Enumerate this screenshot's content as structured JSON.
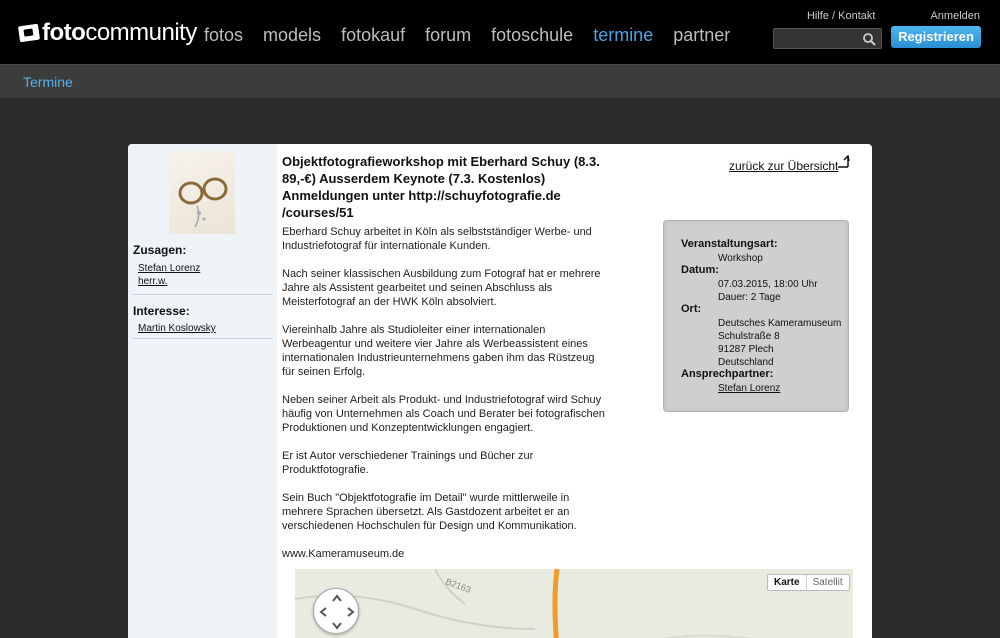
{
  "header": {
    "logo_bold": "foto",
    "logo_light": "community",
    "nav": [
      {
        "label": "fotos",
        "active": false
      },
      {
        "label": "models",
        "active": false
      },
      {
        "label": "fotokauf",
        "active": false
      },
      {
        "label": "forum",
        "active": false
      },
      {
        "label": "fotoschule",
        "active": false
      },
      {
        "label": "termine",
        "active": true
      },
      {
        "label": "partner",
        "active": false
      }
    ],
    "help_link": "Hilfe / Kontakt",
    "login_link": "Anmelden",
    "search_placeholder": "",
    "register_label": "Registrieren",
    "accent_color": "#42a8e8"
  },
  "subbar": {
    "breadcrumb": "Termine"
  },
  "sidebar": {
    "accepted_heading": "Zusagen:",
    "accepted": [
      "Stefan Lorenz",
      "herr.w."
    ],
    "interest_heading": "Interesse:",
    "interested": [
      "Martin Koslowsky"
    ]
  },
  "event": {
    "title": "Objektfotografieworkshop mit Eberhard Schuy (8.3. 89,-€) Ausserdem Keynote (7.3. Kostenlos) Anmeldungen unter http://schuyfotografie.de /courses/51",
    "back_label": "zurück zur Übersicht",
    "paragraphs": [
      "Eberhard Schuy arbeitet in Köln als selbstständiger Werbe- und\nIndustriefotograf für internationale Kunden.",
      "Nach seiner klassischen Ausbildung zum Fotograf hat er mehrere\nJahre als Assistent gearbeitet und seinen Abschluss als\nMeisterfotograf an der HWK Köln absolviert.",
      "Viereinhalb Jahre als Studioleiter einer internationalen\nWerbeagentur und weitere vier Jahre als Werbeassistent eines\ninternationalen Industrieunternehmens gaben ihm das Rüstzeug\nfür seinen Erfolg.",
      "Neben seiner Arbeit als Produkt- und Industriefotograf wird Schuy\nhäufig von Unternehmen als Coach und Berater bei fotografischen\nProduktionen und Konzeptentwicklungen engagiert.",
      "Er ist Autor verschiedener Trainings und Bücher zur\nProduktfotografie.",
      "Sein Buch \"Objektfotografie im Detail\" wurde mittlerweile in\nmehrere Sprachen übersetzt. Als Gastdozent arbeitet er an\nverschiedenen Hochschulen für Design und Kommunikation.",
      "www.Kameramuseum.de"
    ]
  },
  "info": {
    "type_label": "Veranstaltungsart:",
    "type_value": "Workshop",
    "date_label": "Datum:",
    "date_value": "07.03.2015, 18:00 Uhr",
    "duration_value": "Dauer: 2 Tage",
    "place_label": "Ort:",
    "place_lines": [
      "Deutsches Kameramuseum",
      "Schulstraße 8",
      "91287 Plech",
      "Deutschland"
    ],
    "contact_label": "Ansprechpartner:",
    "contact_value": "Stefan Lorenz"
  },
  "map": {
    "road_label": "B2163",
    "map_button": "Karte",
    "satellite_button": "Satellit"
  }
}
